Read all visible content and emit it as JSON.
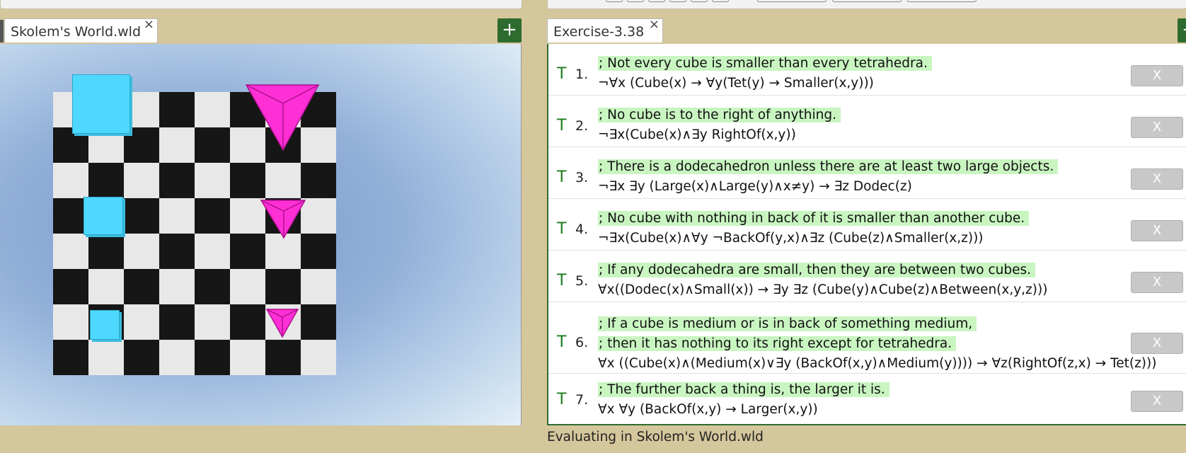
{
  "world_tab": {
    "title": "Skolem's World.wld",
    "close": "×"
  },
  "exercise_tab": {
    "title": "Exercise-3.38",
    "close": "×"
  },
  "add_button_label": "+",
  "sentences": [
    {
      "truth": "T",
      "number": "1.",
      "comments": [
        "; Not every cube is smaller than every tetrahedra."
      ],
      "formula": "¬∀x (Cube(x) → ∀y(Tet(y) → Smaller(x,y)))",
      "delete": "X"
    },
    {
      "truth": "T",
      "number": "2.",
      "comments": [
        "; No cube is to the right of anything."
      ],
      "formula": "¬∃x(Cube(x)∧∃y RightOf(x,y))",
      "delete": "X"
    },
    {
      "truth": "T",
      "number": "3.",
      "comments": [
        "; There is a dodecahedron unless there are at least two large objects."
      ],
      "formula": "¬∃x ∃y (Large(x)∧Large(y)∧x≠y) → ∃z Dodec(z)",
      "delete": "X"
    },
    {
      "truth": "T",
      "number": "4.",
      "comments": [
        "; No cube with nothing in back of it is smaller than another cube."
      ],
      "formula": "¬∃x(Cube(x)∧∀y ¬BackOf(y,x)∧∃z (Cube(z)∧Smaller(x,z)))",
      "delete": "X"
    },
    {
      "truth": "T",
      "number": "5.",
      "comments": [
        "; If any dodecahedra are small, then they are between two cubes."
      ],
      "formula": "∀x((Dodec(x)∧Small(x)) → ∃y ∃z (Cube(y)∧Cube(z)∧Between(x,y,z)))",
      "delete": "X"
    },
    {
      "truth": "T",
      "number": "6.",
      "comments": [
        "; If a cube is medium or is in back of something medium,",
        "; then it has nothing to its right except for tetrahedra."
      ],
      "formula": "∀x ((Cube(x)∧(Medium(x)∨∃y (BackOf(x,y)∧Medium(y)))) → ∀z(RightOf(z,x) → Tet(z)))",
      "delete": "X"
    },
    {
      "truth": "T",
      "number": "7.",
      "comments": [
        "; The further back a thing is, the larger it is."
      ],
      "formula": "∀x ∀y (BackOf(x,y) → Larger(x,y))",
      "delete": "X"
    }
  ],
  "status": "Evaluating in Skolem's World.wld",
  "colors": {
    "cube": "#4fd8ff",
    "tetrahedron": "#ff2fd6",
    "truth_true": "#1b7a1b",
    "comment_highlight": "#c9f5c1",
    "accent_green": "#2e6b2e"
  }
}
